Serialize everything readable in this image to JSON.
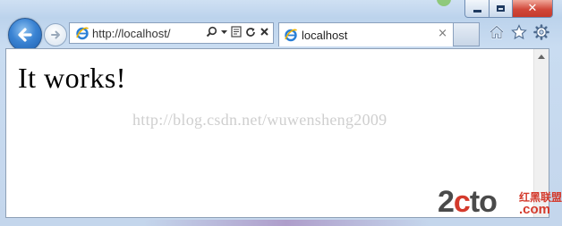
{
  "browser": {
    "address_bar": {
      "url": "http://localhost/"
    },
    "tab": {
      "title": "localhost",
      "close_symbol": "×"
    },
    "caption": {
      "close_symbol": "✕"
    }
  },
  "page": {
    "headline": "It works!",
    "watermark": "http://blog.csdn.net/wuwensheng2009"
  },
  "logo": {
    "main_prefix": "2",
    "main_highlight": "c",
    "main_suffix": "to",
    "sub": "红黑联盟",
    "domain": ".com"
  },
  "icons": {
    "back": "back-arrow-icon",
    "forward": "forward-arrow-icon",
    "search": "search-icon",
    "compat": "compatibility-view-icon",
    "refresh": "refresh-icon",
    "stop": "stop-icon",
    "home": "home-icon",
    "favorites": "favorites-star-icon",
    "tools": "gear-icon"
  },
  "colors": {
    "accent_blue": "#3a83d3",
    "close_red": "#c53a2b",
    "logo_red": "#d43a2c"
  }
}
